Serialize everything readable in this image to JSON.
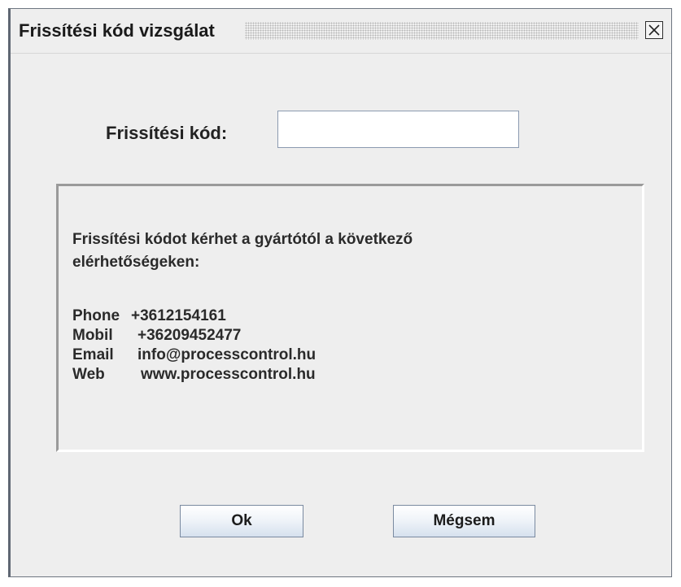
{
  "window": {
    "title": "Frissítési kód vizsgálat",
    "close_icon": "close-icon"
  },
  "form": {
    "code_label": "Frissítési kód:",
    "code_value": "",
    "code_placeholder": ""
  },
  "info": {
    "message": "Frissítési kódot kérhet a gyártótól a következő elérhetőségeken:",
    "contacts": [
      {
        "key": "Phone",
        "value": "+3612154161"
      },
      {
        "key": "Mobil",
        "value": "+36209452477"
      },
      {
        "key": "Email",
        "value": "info@processcontrol.hu"
      },
      {
        "key": "Web",
        "value": "www.processcontrol.hu"
      }
    ]
  },
  "buttons": {
    "ok_label": "Ok",
    "cancel_label": "Mégsem"
  },
  "colors": {
    "background": "#eeeeee",
    "button_gradient_bottom": "#d6e1ee",
    "button_border": "#7a8aa0",
    "input_border": "#8b9ab0"
  }
}
